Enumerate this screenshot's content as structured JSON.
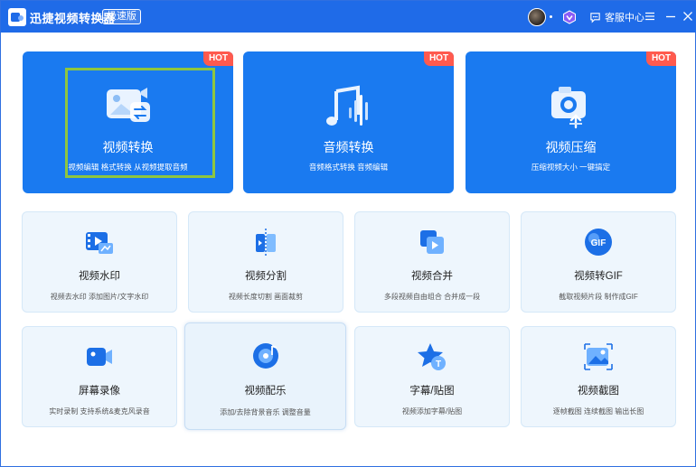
{
  "app": {
    "title": "迅捷视频转换器",
    "edition": "极速版",
    "support_label": "客服中心"
  },
  "featured": [
    {
      "title": "视频转换",
      "subtitle": "视频编辑 格式转换 从视频提取音频",
      "badge": "HOT"
    },
    {
      "title": "音频转换",
      "subtitle": "音频格式转换 音频编辑",
      "badge": "HOT"
    },
    {
      "title": "视频压缩",
      "subtitle": "压缩视频大小 一键搞定",
      "badge": "HOT"
    }
  ],
  "tools": [
    {
      "title": "视频水印",
      "subtitle": "视频去水印 添加图片/文字水印",
      "icon": "watermark-icon"
    },
    {
      "title": "视频分割",
      "subtitle": "视频长度切割 画面裁剪",
      "icon": "split-icon"
    },
    {
      "title": "视频合并",
      "subtitle": "多段视频自由组合 合并成一段",
      "icon": "merge-icon"
    },
    {
      "title": "视频转GIF",
      "subtitle": "截取视频片段 制作成GIF",
      "icon": "gif-icon"
    },
    {
      "title": "屏幕录像",
      "subtitle": "实时录制 支持系统&麦克风录音",
      "icon": "screen-record-icon"
    },
    {
      "title": "视频配乐",
      "subtitle": "添加/去除背景音乐 调整音量",
      "icon": "music-icon"
    },
    {
      "title": "字幕/贴图",
      "subtitle": "视频添加字幕/贴图",
      "icon": "subtitle-sticker-icon"
    },
    {
      "title": "视频截图",
      "subtitle": "逐帧截图 连续截图 输出长图",
      "icon": "screenshot-icon"
    }
  ],
  "colors": {
    "titlebar": "#1f6be8",
    "featured_card": "#1a7af0",
    "hot_badge": "#ff5a4e",
    "tool_card": "#eef6fd",
    "highlight_border": "#8ec63f"
  }
}
